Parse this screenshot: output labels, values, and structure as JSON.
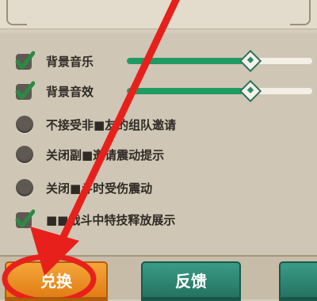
{
  "settings": [
    {
      "label": "背景音乐",
      "checked": true,
      "slider": 0.66
    },
    {
      "label": "背景音效",
      "checked": true,
      "slider": 0.66
    },
    {
      "label": "不接受非■友的组队邀请",
      "checked": false
    },
    {
      "label": "关闭副■邀请震动提示",
      "checked": false
    },
    {
      "label": "关闭■斗时受伤震动",
      "checked": false
    },
    {
      "label": "■■战斗中特技释放展示",
      "checked": true
    }
  ],
  "footer": {
    "redeem_label": "兑换",
    "feedback_label": "反馈",
    "third_label": ""
  },
  "colors": {
    "accent_green": "#1f9a63",
    "orange_button": "#e88a1f",
    "annotation_red": "#e8201c"
  },
  "icons": {
    "checked": "checkmark-icon",
    "unchecked": "radio-dot-icon",
    "slider_handle": "diamond-handle-icon"
  }
}
